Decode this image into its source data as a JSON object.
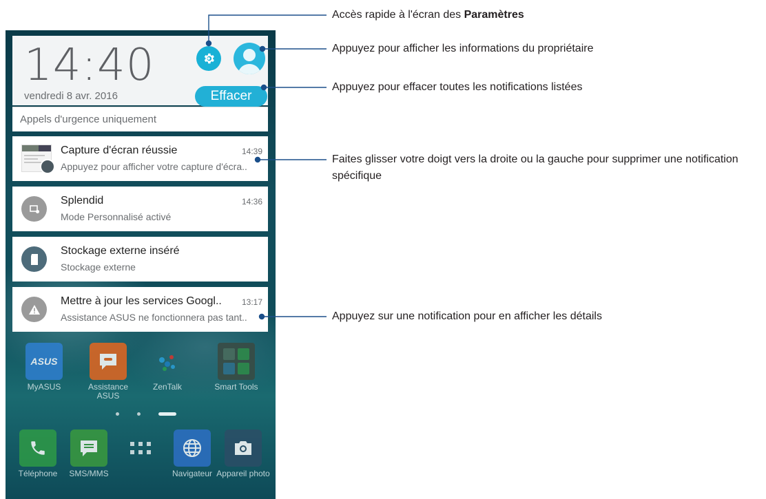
{
  "lockscreen": {
    "clock": "14:40",
    "date": "vendredi 8 avr. 2016",
    "clear_label": "Effacer",
    "emergency": "Appels d'urgence uniquement"
  },
  "notifications": [
    {
      "title": "Capture d'écran réussie",
      "subtitle": "Appuyez pour afficher votre capture d'écra..",
      "time": "14:39",
      "icon": "image-icon"
    },
    {
      "title": "Splendid",
      "subtitle": "Mode Personnalisé activé",
      "time": "14:36",
      "icon": "splendid-icon"
    },
    {
      "title": "Stockage externe inséré",
      "subtitle": "Stockage externe",
      "time": "",
      "icon": "sd-card-icon"
    },
    {
      "title": "Mettre à jour les services Googl..",
      "subtitle": "Assistance ASUS ne fonctionnera pas tant..",
      "time": "13:17",
      "icon": "warning-icon"
    }
  ],
  "home_apps": [
    {
      "label": "MyASUS",
      "icon": "myasus-icon"
    },
    {
      "label": "Assistance ASUS",
      "icon": "chat-icon"
    },
    {
      "label": "ZenTalk",
      "icon": "zentalk-icon"
    },
    {
      "label": "Smart Tools",
      "icon": "smart-tools-icon"
    }
  ],
  "dock_apps": [
    {
      "label": "Téléphone",
      "icon": "phone-icon"
    },
    {
      "label": "SMS/MMS",
      "icon": "message-icon"
    },
    {
      "label": "",
      "icon": "app-drawer-icon"
    },
    {
      "label": "Navigateur",
      "icon": "globe-icon"
    },
    {
      "label": "Appareil photo",
      "icon": "camera-icon"
    }
  ],
  "callouts": {
    "settings_prefix": "Accès rapide à l'écran des ",
    "settings_bold": "Paramètres",
    "owner": "Appuyez pour afficher les informations du propriétaire",
    "clear": "Appuyez pour effacer toutes les notifications listées",
    "swipe": "Faites glisser votre doigt vers la droite ou la gauche pour supprimer une notification spécifique",
    "tap": "Appuyez sur une notification pour en afficher les détails"
  },
  "colors": {
    "accent": "#22b0d6",
    "callout_line": "#1b4f8a",
    "wallpaper": "#124e5c"
  }
}
